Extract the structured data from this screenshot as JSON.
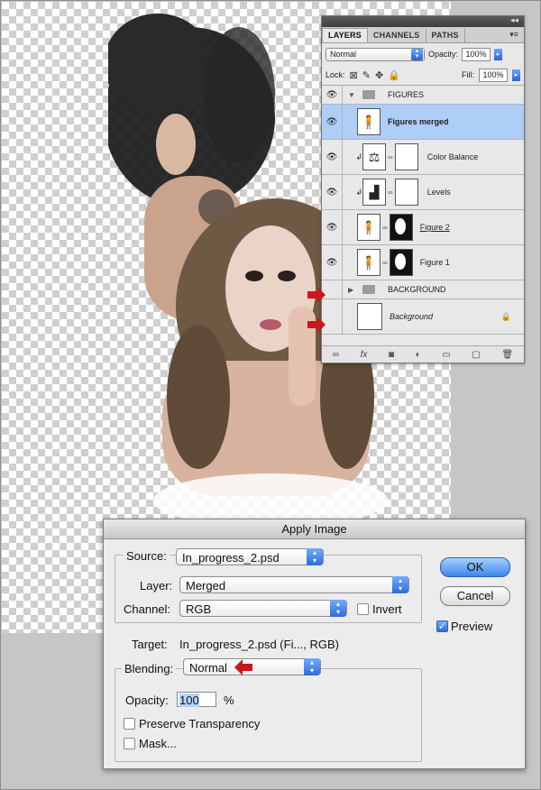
{
  "layers_panel": {
    "tabs": [
      "LAYERS",
      "CHANNELS",
      "PATHS"
    ],
    "blend_mode": "Normal",
    "opacity_label": "Opacity:",
    "opacity_value": "100%",
    "lock_label": "Lock:",
    "fill_label": "Fill:",
    "fill_value": "100%",
    "layers": [
      {
        "name": "FIGURES"
      },
      {
        "name": "Figures merged"
      },
      {
        "name": "Color Balance"
      },
      {
        "name": "Levels"
      },
      {
        "name": "Figure 2"
      },
      {
        "name": "Figure 1"
      },
      {
        "name": "BACKGROUND"
      },
      {
        "name": "Background"
      }
    ]
  },
  "dialog": {
    "title": "Apply Image",
    "source_label": "Source:",
    "source_value": "In_progress_2.psd",
    "layer_label": "Layer:",
    "layer_value": "Merged",
    "channel_label": "Channel:",
    "channel_value": "RGB",
    "invert_label": "Invert",
    "target_label": "Target:",
    "target_value": "In_progress_2.psd (Fi..., RGB)",
    "blending_label": "Blending:",
    "blending_value": "Normal",
    "opacity_label": "Opacity:",
    "opacity_value": "100",
    "opacity_unit": "%",
    "preserve_label": "Preserve Transparency",
    "mask_label": "Mask...",
    "ok_label": "OK",
    "cancel_label": "Cancel",
    "preview_label": "Preview",
    "preview_checked": true
  },
  "colors": {
    "accent": "#3c85ec",
    "arrow": "#c8181c",
    "selection": "#aecdf7"
  }
}
